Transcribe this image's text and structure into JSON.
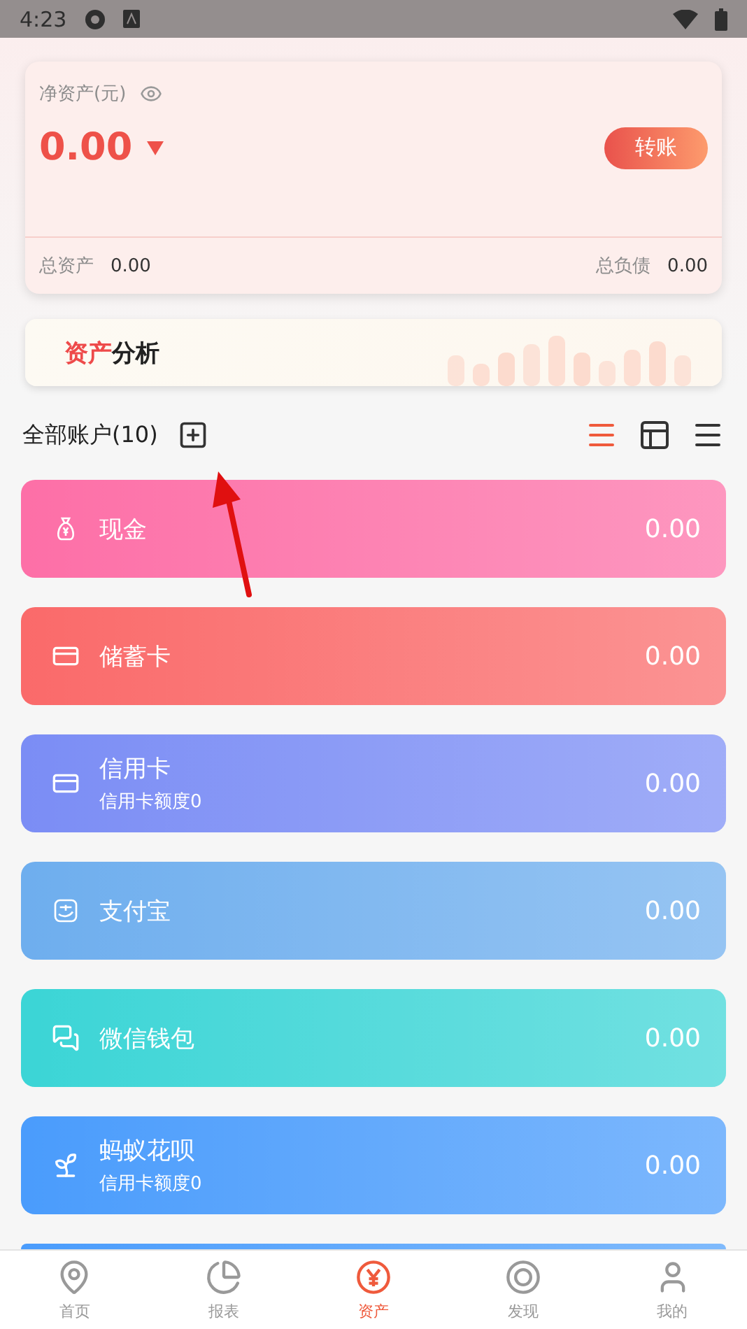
{
  "status_bar": {
    "time": "4:23"
  },
  "net_worth": {
    "label": "净资产(元)",
    "amount": "0.00",
    "transfer_button": "转账",
    "total_assets_label": "总资产",
    "total_assets": "0.00",
    "total_debt_label": "总负债",
    "total_debt": "0.00"
  },
  "banner": {
    "title_parts": [
      "资产",
      "分析"
    ]
  },
  "accounts_header": {
    "title": "全部账户(10)",
    "view_modes": [
      {
        "selected": true
      },
      {
        "selected": false
      },
      {
        "selected": false
      }
    ]
  },
  "accounts": [
    {
      "kind": "cash",
      "name": "现金",
      "amount": "0.00",
      "color": "#fd6fa7"
    },
    {
      "kind": "debit",
      "name": "储蓄卡",
      "amount": "0.00",
      "color": "#fa6a6a"
    },
    {
      "kind": "credit",
      "name": "信用卡",
      "subtitle": "信用卡额度0",
      "amount": "0.00",
      "color": "#7b8df5"
    },
    {
      "kind": "alipay",
      "name": "支付宝",
      "amount": "0.00",
      "color": "#6eaeee"
    },
    {
      "kind": "wechat",
      "name": "微信钱包",
      "amount": "0.00",
      "color": "#3bd5d6"
    },
    {
      "kind": "huabei",
      "name": "蚂蚁花呗",
      "subtitle": "信用卡额度0",
      "amount": "0.00",
      "color": "#4a9cfc"
    }
  ],
  "bottom_nav": [
    {
      "label": "首页",
      "selected": false
    },
    {
      "label": "报表",
      "selected": false
    },
    {
      "label": "资产",
      "selected": true
    },
    {
      "label": "发现",
      "selected": false
    },
    {
      "label": "我的",
      "selected": false
    }
  ]
}
